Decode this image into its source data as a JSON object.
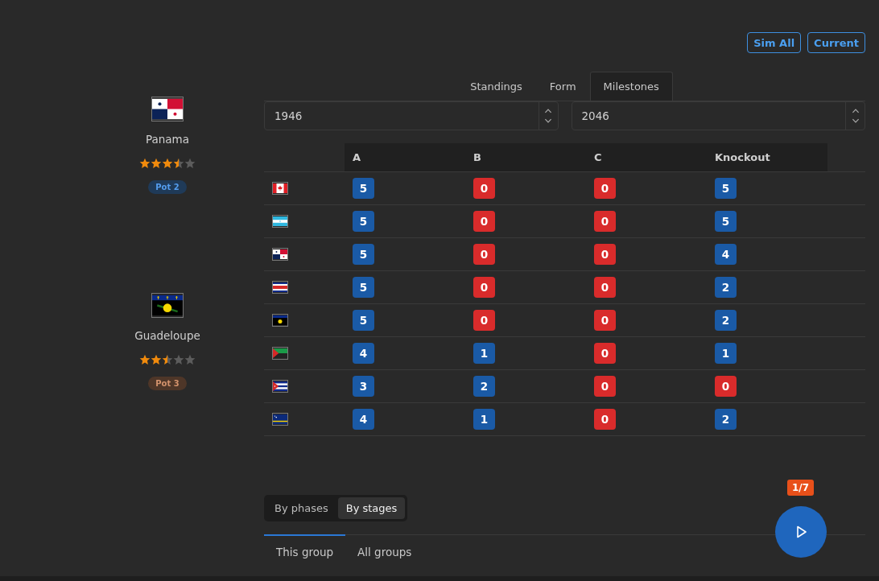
{
  "toolbar": {
    "buttons": [
      "Sim All",
      "Current"
    ]
  },
  "teams": [
    {
      "name": "Panama",
      "kind": "panama",
      "stars": 3.5,
      "pot": {
        "label": "Pot 2",
        "color": "#1f3a58"
      }
    },
    {
      "name": "Guadeloupe",
      "kind": "guadeloupe",
      "stars": 2.5,
      "pot": {
        "label": "Pot 3",
        "color": "#4e3628"
      }
    }
  ],
  "tabs": [
    {
      "label": "Standings",
      "selected": false
    },
    {
      "label": "Form",
      "selected": false
    },
    {
      "label": "Milestones",
      "selected": true
    }
  ],
  "range": {
    "from": "1946",
    "to": "2046"
  },
  "table": {
    "columns": [
      "A",
      "B",
      "C",
      "Knockout"
    ],
    "rows": [
      {
        "kind": "canada",
        "cells": [
          {
            "value": "5",
            "color": "#1a5aa6"
          },
          {
            "value": "0",
            "color": "#d92b2b"
          },
          {
            "value": "0",
            "color": "#d92b2b"
          },
          {
            "value": "5",
            "color": "#1a5aa6"
          }
        ]
      },
      {
        "kind": "honduras",
        "cells": [
          {
            "value": "5",
            "color": "#1a5aa6"
          },
          {
            "value": "0",
            "color": "#d92b2b"
          },
          {
            "value": "0",
            "color": "#d92b2b"
          },
          {
            "value": "5",
            "color": "#1a5aa6"
          }
        ]
      },
      {
        "kind": "panama",
        "cells": [
          {
            "value": "5",
            "color": "#1a5aa6"
          },
          {
            "value": "0",
            "color": "#d92b2b"
          },
          {
            "value": "0",
            "color": "#d92b2b"
          },
          {
            "value": "4",
            "color": "#1a5aa6"
          }
        ]
      },
      {
        "kind": "costarica",
        "cells": [
          {
            "value": "5",
            "color": "#1a5aa6"
          },
          {
            "value": "0",
            "color": "#d92b2b"
          },
          {
            "value": "0",
            "color": "#d92b2b"
          },
          {
            "value": "2",
            "color": "#1a5aa6"
          }
        ]
      },
      {
        "kind": "guadeloupe",
        "cells": [
          {
            "value": "5",
            "color": "#1a5aa6"
          },
          {
            "value": "0",
            "color": "#d92b2b"
          },
          {
            "value": "0",
            "color": "#d92b2b"
          },
          {
            "value": "2",
            "color": "#1a5aa6"
          }
        ]
      },
      {
        "kind": "martinique",
        "cells": [
          {
            "value": "4",
            "color": "#1a5aa6"
          },
          {
            "value": "1",
            "color": "#1a5aa6"
          },
          {
            "value": "0",
            "color": "#d92b2b"
          },
          {
            "value": "1",
            "color": "#1a5aa6"
          }
        ]
      },
      {
        "kind": "cuba",
        "cells": [
          {
            "value": "3",
            "color": "#1a5aa6"
          },
          {
            "value": "2",
            "color": "#1a5aa6"
          },
          {
            "value": "0",
            "color": "#d92b2b"
          },
          {
            "value": "0",
            "color": "#d92b2b"
          }
        ]
      },
      {
        "kind": "curacao",
        "cells": [
          {
            "value": "4",
            "color": "#1a5aa6"
          },
          {
            "value": "1",
            "color": "#1a5aa6"
          },
          {
            "value": "0",
            "color": "#d92b2b"
          },
          {
            "value": "2",
            "color": "#1a5aa6"
          }
        ]
      }
    ]
  },
  "view_toggle": [
    {
      "label": "By phases",
      "selected": false
    },
    {
      "label": "By stages",
      "selected": true
    }
  ],
  "bottom_tabs": [
    {
      "label": "This group",
      "selected": true
    },
    {
      "label": "All groups",
      "selected": false
    }
  ],
  "play": {
    "counter": "1/7"
  }
}
